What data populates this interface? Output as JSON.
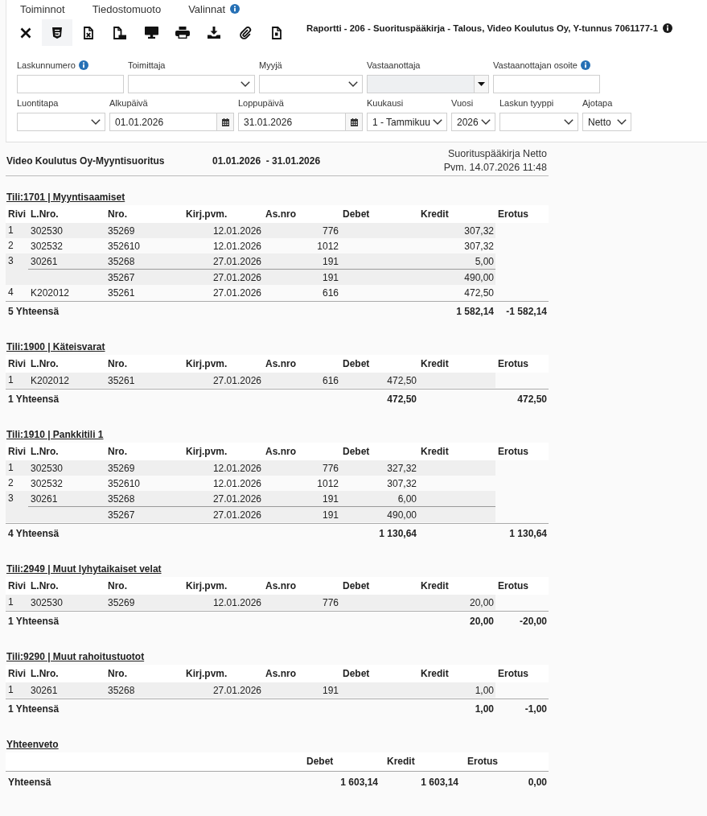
{
  "menu": [
    {
      "label": "Toiminnot",
      "info": false
    },
    {
      "label": "Tiedostomuoto",
      "info": false
    },
    {
      "label": "Valinnat",
      "info": true
    }
  ],
  "toolbar": [
    {
      "kind": "close",
      "selected": false
    },
    {
      "kind": "html",
      "selected": true
    },
    {
      "kind": "excel",
      "selected": false
    },
    {
      "kind": "pdf",
      "selected": false
    },
    {
      "kind": "screen",
      "selected": false
    },
    {
      "kind": "print",
      "selected": false
    },
    {
      "kind": "download",
      "selected": false
    },
    {
      "kind": "attach",
      "selected": false
    },
    {
      "kind": "document",
      "selected": false
    }
  ],
  "report_title": {
    "text": "Raportti - 206 - Suorituspääkirja - Talous, Video Koulutus Oy, Y-tunnus 7061177-1",
    "info": true
  },
  "filters": [
    [
      {
        "label": "Laskunnumero",
        "info": true,
        "kind": "text",
        "disabled": false
      },
      {
        "label": "Toimittaja",
        "info": false,
        "kind": "select",
        "disabled": false
      },
      {
        "label": "Myyjä",
        "info": false,
        "kind": "select",
        "disabled": false
      },
      {
        "label": "Vastaanottaja",
        "info": false,
        "kind": "combo",
        "disabled": true
      },
      {
        "label": "Vastaanottajan osoite",
        "info": true,
        "kind": "text",
        "disabled": false
      }
    ],
    [
      {
        "label": "Luontitapa",
        "info": false,
        "kind": "select",
        "disabled": false
      },
      {
        "label": "Alkupäivä",
        "info": false,
        "kind": "date",
        "disabled": false,
        "value": "01.01.2026"
      },
      {
        "label": "Loppupäivä",
        "info": false,
        "kind": "date",
        "disabled": false,
        "value": "31.01.2026"
      },
      {
        "label": "Kuukausi",
        "info": false,
        "kind": "select",
        "disabled": false,
        "value": "1 - Tammikuu"
      },
      {
        "label": "Vuosi",
        "info": false,
        "kind": "select",
        "disabled": false,
        "value": "2026"
      },
      {
        "label": "Laskun tyyppi",
        "info": false,
        "kind": "select",
        "disabled": false
      },
      {
        "label": "Ajotapa",
        "info": false,
        "kind": "select",
        "disabled": false,
        "value": "Netto"
      }
    ]
  ],
  "report": {
    "company_title": "Video Koulutus Oy-Myyntisuoritus",
    "period": "01.01.2026  - 31.01.2026",
    "report_name": "Suorituspääkirja Netto",
    "printed": "Pvm. 14.07.2026 11:48"
  },
  "accounts": [
    {
      "title": "Tili:1701 | Myyntisaamiset",
      "columns": [
        "Rivi",
        "L.Nro.",
        "Nro.",
        "Kirj.pvm.",
        "As.nro",
        "Debet",
        "Kredit",
        "Erotus"
      ],
      "groups": [
        {
          "rivi": "1",
          "entries": [
            {
              "lnro": "302530",
              "nro": "35269",
              "date": "12.01.2026",
              "as_nro": "776",
              "kredit": "307,32"
            }
          ]
        },
        {
          "rivi": "2",
          "entries": [
            {
              "lnro": "302532",
              "nro": "352610",
              "date": "12.01.2026",
              "as_nro": "1012",
              "kredit": "307,32"
            }
          ]
        },
        {
          "rivi": "3",
          "entries": [
            {
              "lnro": "30261",
              "nro": "35268",
              "date": "27.01.2026",
              "as_nro": "191",
              "kredit": "5,00"
            },
            {
              "nro": "35267",
              "date": "27.01.2026",
              "as_nro": "191",
              "kredit": "490,00"
            }
          ]
        },
        {
          "rivi": "4",
          "entries": [
            {
              "lnro": "K202012",
              "nro": "35261",
              "date": "27.01.2026",
              "as_nro": "616",
              "kredit": "472,50"
            }
          ]
        }
      ],
      "total": {
        "label": "5 Yhteensä",
        "kredit": "1 582,14",
        "erotus": "-1 582,14"
      }
    },
    {
      "title": "Tili:1900 | Käteisvarat",
      "columns": [
        "Rivi",
        "L.Nro.",
        "Nro.",
        "Kirj.pvm.",
        "As.nro",
        "Debet",
        "Kredit",
        "Erotus"
      ],
      "groups": [
        {
          "rivi": "1",
          "entries": [
            {
              "lnro": "K202012",
              "nro": "35261",
              "date": "27.01.2026",
              "as_nro": "616",
              "debet": "472,50"
            }
          ]
        }
      ],
      "total": {
        "label": "1 Yhteensä",
        "debet": "472,50",
        "erotus": "472,50"
      }
    },
    {
      "title": "Tili:1910 | Pankkitili 1",
      "columns": [
        "Rivi",
        "L.Nro.",
        "Nro.",
        "Kirj.pvm.",
        "As.nro",
        "Debet",
        "Kredit",
        "Erotus"
      ],
      "groups": [
        {
          "rivi": "1",
          "entries": [
            {
              "lnro": "302530",
              "nro": "35269",
              "date": "12.01.2026",
              "as_nro": "776",
              "debet": "327,32"
            }
          ]
        },
        {
          "rivi": "2",
          "entries": [
            {
              "lnro": "302532",
              "nro": "352610",
              "date": "12.01.2026",
              "as_nro": "1012",
              "debet": "307,32"
            }
          ]
        },
        {
          "rivi": "3",
          "entries": [
            {
              "lnro": "30261",
              "nro": "35268",
              "date": "27.01.2026",
              "as_nro": "191",
              "debet": "6,00"
            },
            {
              "nro": "35267",
              "date": "27.01.2026",
              "as_nro": "191",
              "debet": "490,00"
            }
          ]
        }
      ],
      "total": {
        "label": "4 Yhteensä",
        "debet": "1 130,64",
        "erotus": "1 130,64"
      }
    },
    {
      "title": "Tili:2949 | Muut lyhytaikaiset velat",
      "columns": [
        "Rivi",
        "L.Nro.",
        "Nro.",
        "Kirj.pvm.",
        "As.nro",
        "Debet",
        "Kredit",
        "Erotus"
      ],
      "groups": [
        {
          "rivi": "1",
          "entries": [
            {
              "lnro": "302530",
              "nro": "35269",
              "date": "12.01.2026",
              "as_nro": "776",
              "kredit": "20,00"
            }
          ]
        }
      ],
      "total": {
        "label": "1 Yhteensä",
        "kredit": "20,00",
        "erotus": "-20,00"
      }
    },
    {
      "title": "Tili:9290 | Muut rahoitustuotot",
      "columns": [
        "Rivi",
        "L.Nro.",
        "Nro.",
        "Kirj.pvm.",
        "As.nro",
        "Debet",
        "Kredit",
        "Erotus"
      ],
      "groups": [
        {
          "rivi": "1",
          "entries": [
            {
              "lnro": "30261",
              "nro": "35268",
              "date": "27.01.2026",
              "as_nro": "191",
              "kredit": "1,00"
            }
          ]
        }
      ],
      "total": {
        "label": "1 Yhteensä",
        "kredit": "1,00",
        "erotus": "-1,00"
      }
    }
  ],
  "summary": {
    "title": "Yhteenveto",
    "columns": [
      "Debet",
      "Kredit",
      "Erotus"
    ],
    "label": "Yhteensä",
    "values": [
      "1 603,14",
      "1 603,14",
      "0,00"
    ]
  }
}
